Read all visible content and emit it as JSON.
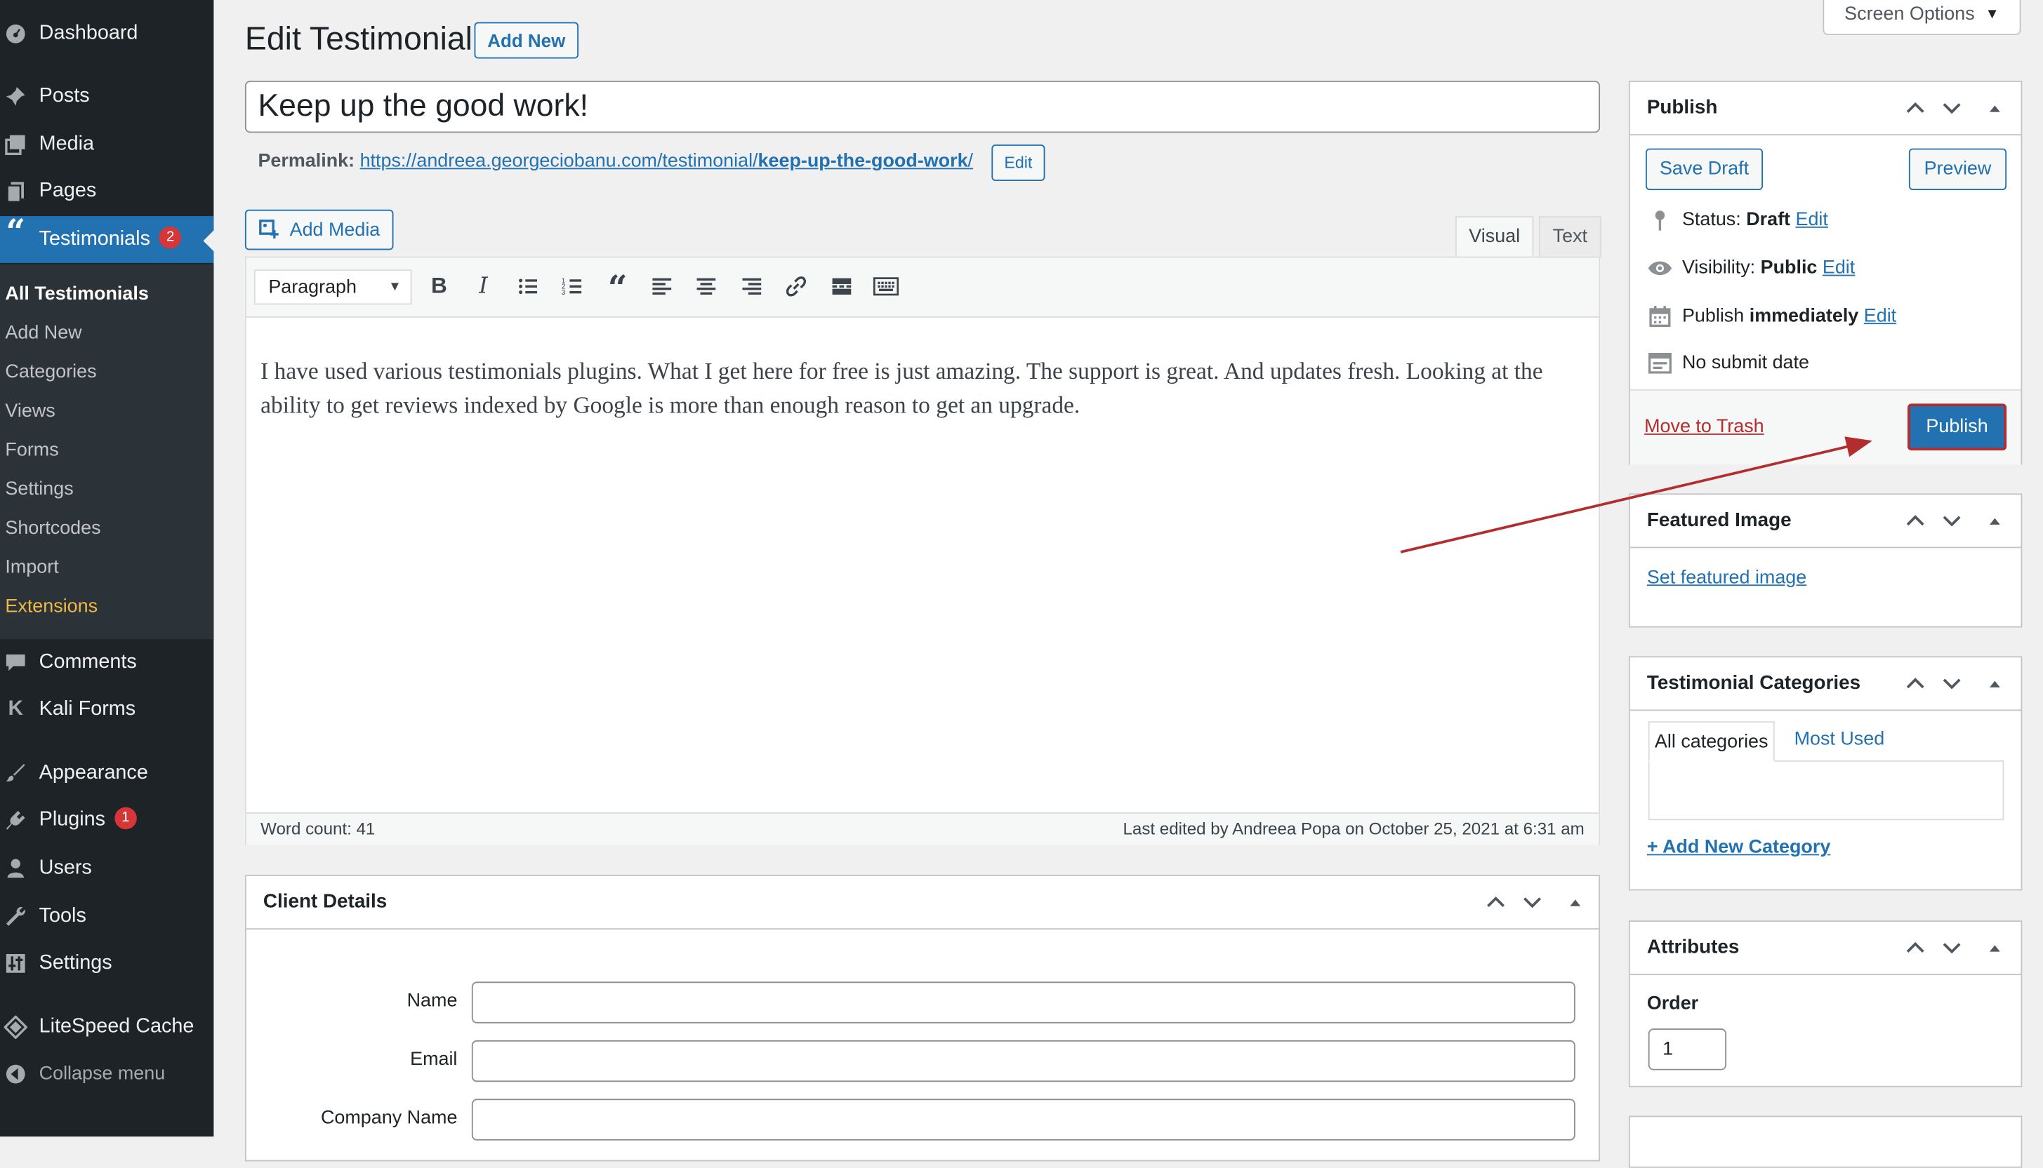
{
  "sidebar": {
    "items": [
      {
        "label": "Dashboard",
        "icon": "dashboard-icon"
      },
      {
        "label": "Posts",
        "icon": "pin-icon"
      },
      {
        "label": "Media",
        "icon": "media-icon"
      },
      {
        "label": "Pages",
        "icon": "pages-icon"
      },
      {
        "label": "Testimonials",
        "icon": "quote-icon",
        "badge": "2"
      },
      {
        "label": "Comments",
        "icon": "comment-icon"
      },
      {
        "label": "Kali Forms",
        "icon": "kali-k-icon"
      },
      {
        "label": "Appearance",
        "icon": "brush-icon"
      },
      {
        "label": "Plugins",
        "icon": "plugin-icon",
        "badge": "1"
      },
      {
        "label": "Users",
        "icon": "user-icon"
      },
      {
        "label": "Tools",
        "icon": "wrench-icon"
      },
      {
        "label": "Settings",
        "icon": "settings-icon"
      },
      {
        "label": "LiteSpeed Cache",
        "icon": "diamond-icon"
      },
      {
        "label": "Collapse menu",
        "icon": "collapse-icon"
      }
    ],
    "submenu": [
      "All Testimonials",
      "Add New",
      "Categories",
      "Views",
      "Forms",
      "Settings",
      "Shortcodes",
      "Import",
      "Extensions"
    ]
  },
  "header": {
    "title": "Edit Testimonial",
    "add_new": "Add New",
    "screen_options": "Screen Options"
  },
  "post": {
    "title": "Keep up the good work!",
    "permalink_label": "Permalink:",
    "permalink_base": "https://andreea.georgeciobanu.com/testimonial/",
    "permalink_slug": "keep-up-the-good-work",
    "permalink_end": "/",
    "permalink_edit": "Edit"
  },
  "editor": {
    "add_media": "Add Media",
    "tab_visual": "Visual",
    "tab_text": "Text",
    "format": "Paragraph",
    "content": "I have used various testimonials plugins. What I get here for free is just amazing. The support is great. And updates fresh. Looking at the ability to get reviews indexed by Google is more than enough reason to get an upgrade.",
    "word_count": "Word count: 41",
    "last_edited": "Last edited by Andreea Popa on October 25, 2021 at 6:31 am"
  },
  "client_details": {
    "title": "Client Details",
    "fields": [
      "Name",
      "Email",
      "Company Name"
    ]
  },
  "publish": {
    "title": "Publish",
    "save_draft": "Save Draft",
    "preview": "Preview",
    "status_label": "Status:",
    "status_value": "Draft",
    "visibility_label": "Visibility:",
    "visibility_value": "Public",
    "publish_label": "Publish",
    "publish_value": "immediately",
    "edit": "Edit",
    "no_submit": "No submit date",
    "trash": "Move to Trash",
    "publish_button": "Publish"
  },
  "featured_image": {
    "title": "Featured Image",
    "link": "Set featured image"
  },
  "categories": {
    "title": "Testimonial Categories",
    "tab_all": "All categories",
    "tab_used": "Most Used",
    "add_new": "+ Add New Category"
  },
  "attributes": {
    "title": "Attributes",
    "order_label": "Order",
    "order_value": "1"
  },
  "colors": {
    "accent": "#2271b1",
    "sidebar": "#1d2327",
    "annotation": "#b32d2e",
    "trash": "#b32d2e"
  }
}
